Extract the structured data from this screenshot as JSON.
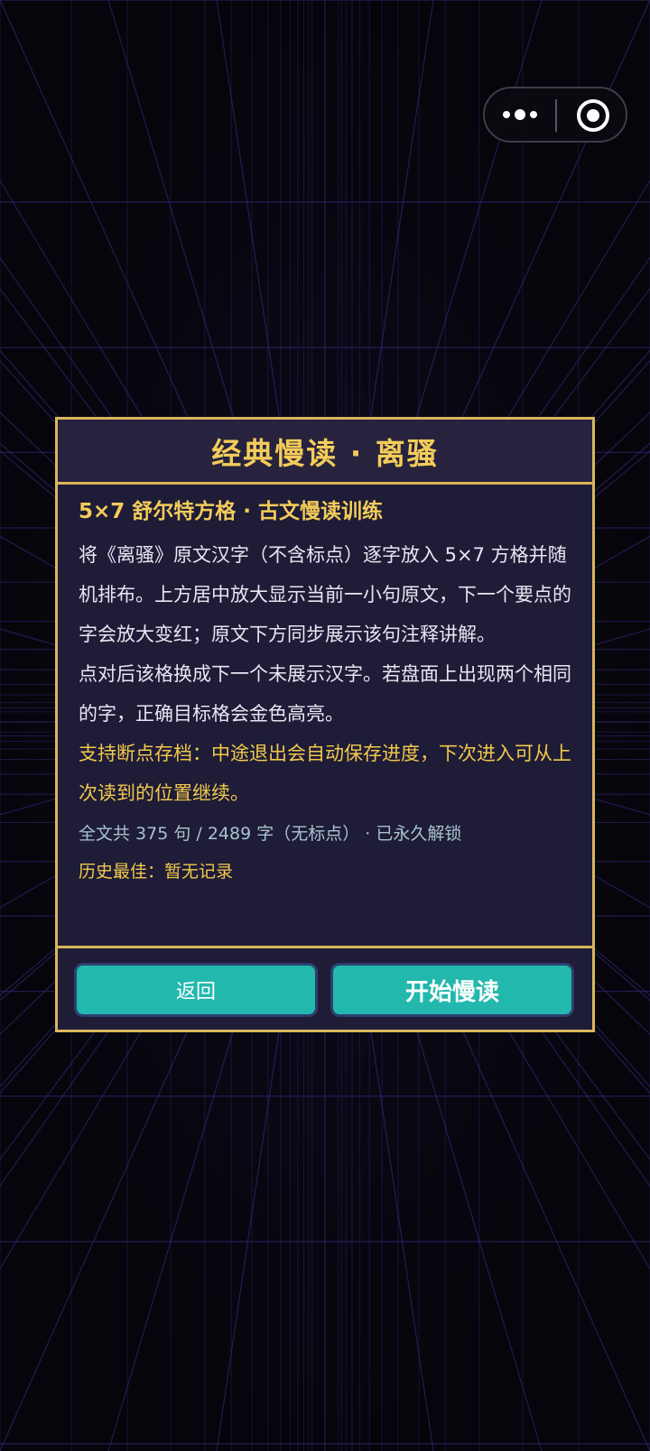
{
  "capsule": {
    "more_icon": "more-dots-icon",
    "close_icon": "target-close-icon"
  },
  "dialog": {
    "title": "经典慢读 · 离骚",
    "subtitle": "5×7 舒尔特方格 · 古文慢读训练",
    "paragraphs": [
      "将《离骚》原文汉字（不含标点）逐字放入 5×7 方格并随机排布。上方居中放大显示当前一小句原文，下一个要点的字会放大变红；原文下方同步展示该句注释讲解。",
      "点对后该格换成下一个未展示汉字。若盘面上出现两个相同的字，正确目标格会金色高亮。"
    ],
    "highlight": "支持断点存档：中途退出会自动保存进度，下次进入可从上次读到的位置继续。",
    "stats": "全文共 375 句 / 2489 字（无标点） · 已永久解锁",
    "best": "历史最佳：暂无记录",
    "back_label": "返回",
    "start_label": "开始慢读"
  },
  "colors": {
    "accent_gold": "#d9b65a",
    "title_gold": "#f3cc5a",
    "button_teal": "#22b8ad",
    "panel": "#1e1c37",
    "grid_line": "#3a2f8a"
  }
}
